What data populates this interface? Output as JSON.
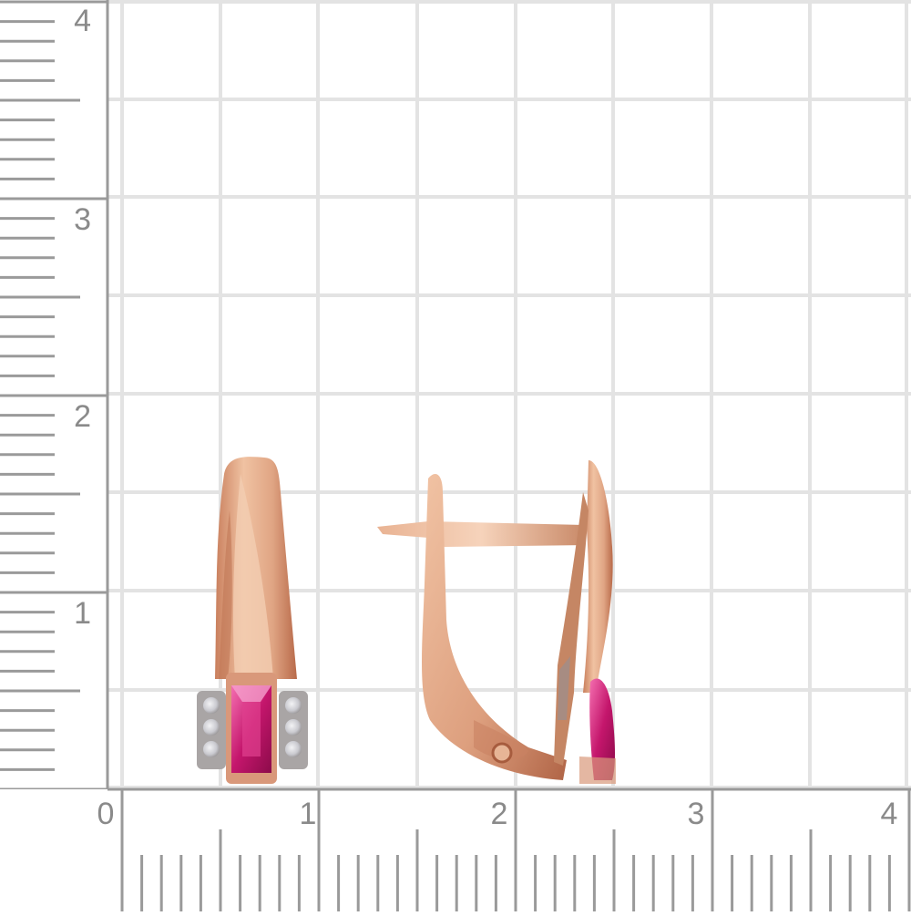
{
  "ruler": {
    "y_labels": [
      "4",
      "3",
      "2",
      "1"
    ],
    "x_labels": [
      "0",
      "1",
      "2",
      "3",
      "4"
    ],
    "unit_note": ""
  },
  "colors": {
    "background": "#ffffff",
    "grid": "#e3e3e3",
    "ruler_ticks": "#9a9a9a",
    "ruler_text": "#8a8a8a",
    "gold_light": "#f2c4a6",
    "gold_mid": "#d9987a",
    "gold_dark": "#b86a4a",
    "ruby": "#c2186a",
    "ruby_light": "#f05aa4",
    "diamond": "#cfcfd4"
  },
  "scene": {
    "subject": "earring-pair",
    "items": [
      "earring-front-view",
      "earring-side-view"
    ]
  }
}
